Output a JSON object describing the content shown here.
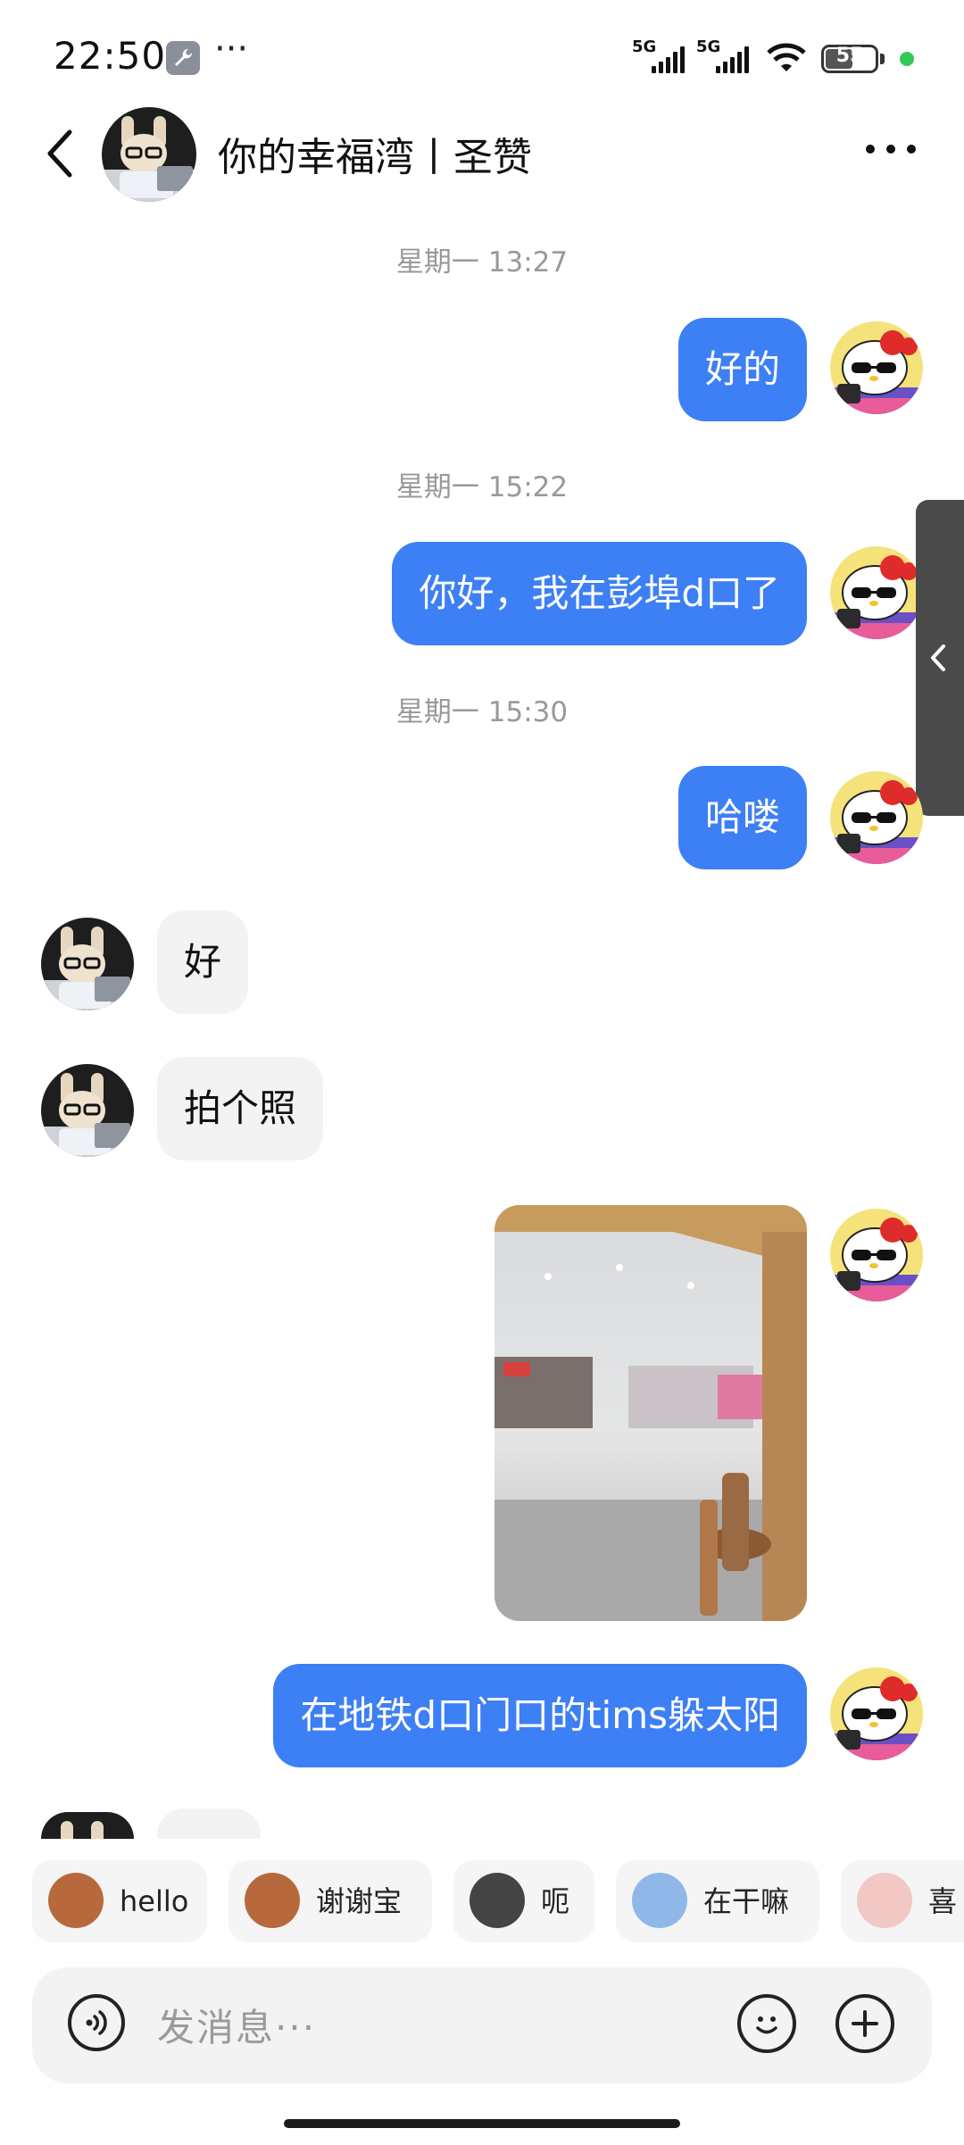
{
  "status_bar": {
    "time": "22:50",
    "more": "···",
    "signal1_label": "5G",
    "signal2_label": "5G",
    "battery": "55",
    "battery_fraction": 0.55
  },
  "header": {
    "title": "你的幸福湾丨圣赞"
  },
  "messages": {
    "ts1": "星期一 13:27",
    "m1": "好的",
    "ts2": "星期一 15:22",
    "m2": "你好，我在彭埠d口了",
    "ts3": "星期一 15:30",
    "m3": "哈喽",
    "r1": "好",
    "r2": "拍个照",
    "m4": "在地铁d口门口的tims躲太阳"
  },
  "quick_replies": [
    "hello",
    "谢谢宝",
    "呃",
    "在干嘛",
    "喜"
  ],
  "input": {
    "placeholder": "发消息···"
  },
  "colors": {
    "accent": "#3d7ff4",
    "incoming_bubble": "#f3f3f3",
    "timestamp": "#999999"
  },
  "icons": {
    "back": "chevron-left-icon",
    "more": "more-horizontal-icon",
    "voice": "voice-icon",
    "emoji": "emoji-icon",
    "plus": "plus-icon"
  }
}
